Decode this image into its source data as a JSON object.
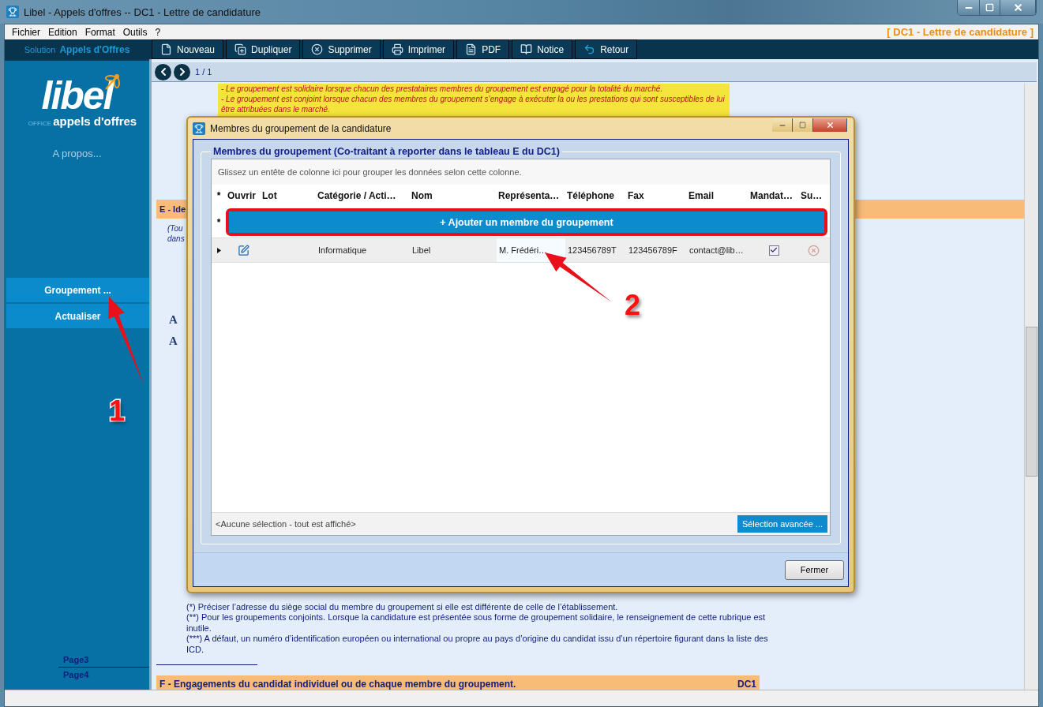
{
  "window": {
    "title": "Libel - Appels d'offres -- DC1 - Lettre de candidature"
  },
  "menu": [
    "Fichier",
    "Edition",
    "Format",
    "Outils",
    "?"
  ],
  "header_title": "[ DC1 - Lettre de candidature ]",
  "solution": {
    "label": "Solution",
    "name": "Appels d'Offres"
  },
  "toolbar": [
    "Nouveau",
    "Dupliquer",
    "Supprimer",
    "Imprimer",
    "PDF",
    "Notice",
    "Retour"
  ],
  "sidebar": {
    "logo": {
      "brand": "libel",
      "office": "OFFICE",
      "product": "appels d'offres"
    },
    "about": "A propos...",
    "buttons": [
      "Groupement ...",
      "Actualiser"
    ],
    "pages": [
      "Page3",
      "Page4"
    ]
  },
  "pager": "1 / 1",
  "document": {
    "notice_lines": [
      "- Le groupement est solidaire lorsque chacun des prestataires membres du groupement est engagé pour la totalité du marché.",
      "- Le groupement est conjoint lorsque chacun des membres du groupement s’engage à exécuter la ou les prestations qui sont susceptibles de lui être attribuées dans le marché."
    ],
    "section_e": "E - Ide",
    "fragments": [
      "(Tou",
      "dans"
    ],
    "font_buttons": [
      "A",
      "A"
    ],
    "footnotes": [
      "(*) Préciser l’adresse du siège social du membre du groupement si elle est différente de celle de l’établissement.",
      "(**) Pour les groupements conjoints. Lorsque la candidature est présentée sous forme de groupement solidaire, le renseignement de cette rubrique est inutile.",
      "(***) A défaut, un numéro d’identification européen ou international ou propre au pays d’origine du candidat issu d’un répertoire figurant dans la liste des ICD."
    ],
    "section_f": {
      "title": "F - Engagements du candidat individuel ou de chaque membre du groupement.",
      "code": "DC1"
    }
  },
  "dialog": {
    "title": "Membres du groupement de la candidature",
    "group_title": "Membres du groupement (Co-traitant à reporter dans le tableau E du DC1)",
    "group_hint": "Glissez un entête de colonne ici pour grouper les données selon cette colonne.",
    "star": "*",
    "columns": [
      "Ouvrir",
      "Lot",
      "Catégorie / Acti…",
      "Nom",
      "Représenta…",
      "Téléphone",
      "Fax",
      "Email",
      "Mandat…",
      "Su…"
    ],
    "add_button": "+ Ajouter un membre du groupement",
    "rows": [
      {
        "category": "Informatique",
        "name": "Libel",
        "representative": "M. Frédéri…",
        "phone": "123456789T",
        "fax": "123456789F",
        "email": "contact@lib…",
        "mandataire": true
      }
    ],
    "footer_text": "<Aucune sélection - tout est affiché>",
    "advanced_button": "Sélection avancée ...",
    "close_button": "Fermer"
  },
  "annotations": [
    {
      "label": "1"
    },
    {
      "label": "2"
    }
  ]
}
